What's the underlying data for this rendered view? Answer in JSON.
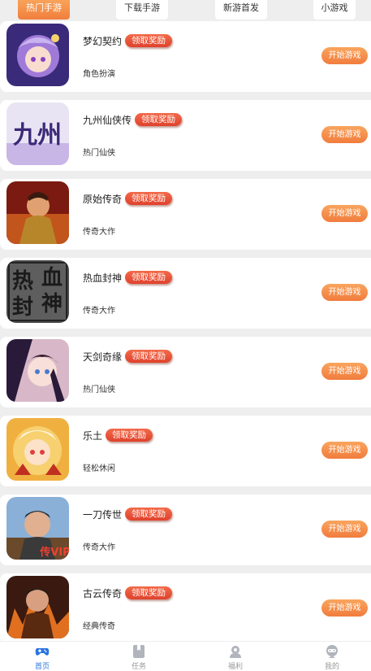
{
  "tabs": [
    "热门手游",
    "下载手游",
    "新游首发",
    "小游戏"
  ],
  "badge_label": "领取奖励",
  "play_label": "开始游戏",
  "games": [
    {
      "name": "梦幻契约",
      "category": "角色扮演"
    },
    {
      "name": "九州仙侠传",
      "category": "热门仙侠"
    },
    {
      "name": "原始传奇",
      "category": "传奇大作"
    },
    {
      "name": "热血封神",
      "category": "传奇大作"
    },
    {
      "name": "天剑奇缘",
      "category": "热门仙侠"
    },
    {
      "name": "乐土",
      "category": "轻松休闲"
    },
    {
      "name": "一刀传世",
      "category": "传奇大作"
    },
    {
      "name": "古云传奇",
      "category": "经典传奇"
    }
  ],
  "thumb_art": {
    "九州仙侠传": "九州",
    "热血封神": [
      "热",
      "血",
      "封",
      "神"
    ],
    "一刀传世": "传VIP"
  },
  "bottom_nav": [
    {
      "label": "首页",
      "icon": "gamepad-icon",
      "active": true
    },
    {
      "label": "任务",
      "icon": "task-icon",
      "active": false
    },
    {
      "label": "福利",
      "icon": "gift-icon",
      "active": false
    },
    {
      "label": "我的",
      "icon": "user-icon",
      "active": false
    }
  ],
  "colors": {
    "accent": "#f17c3d",
    "badge": "#e0412c",
    "nav_active": "#2a74e0"
  }
}
